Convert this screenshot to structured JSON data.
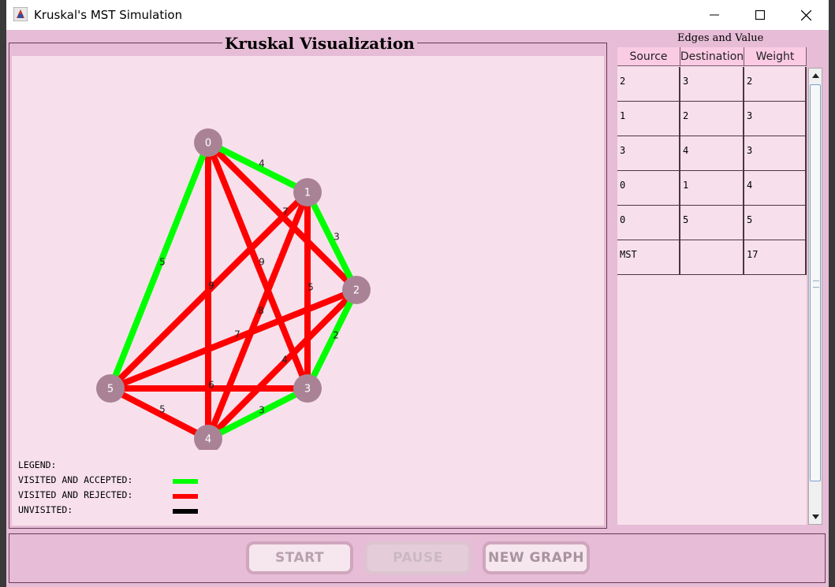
{
  "window": {
    "title": "Kruskal's MST Simulation"
  },
  "visualization": {
    "title": "Kruskal Visualization",
    "colors": {
      "accepted": "#00ff00",
      "rejected": "#ff0000",
      "unvisited": "#000000",
      "node": "#a98395"
    },
    "nodes": [
      {
        "id": "0"
      },
      {
        "id": "1"
      },
      {
        "id": "2"
      },
      {
        "id": "3"
      },
      {
        "id": "4"
      },
      {
        "id": "5"
      }
    ],
    "edges": [
      {
        "from": "0",
        "to": "1",
        "weight": "4",
        "status": "accepted"
      },
      {
        "from": "1",
        "to": "2",
        "weight": "3",
        "status": "accepted"
      },
      {
        "from": "2",
        "to": "3",
        "weight": "2",
        "status": "accepted"
      },
      {
        "from": "3",
        "to": "4",
        "weight": "3",
        "status": "accepted"
      },
      {
        "from": "0",
        "to": "5",
        "weight": "5",
        "status": "accepted"
      },
      {
        "from": "0",
        "to": "4",
        "weight": "9",
        "status": "rejected"
      },
      {
        "from": "0",
        "to": "3",
        "weight": "9",
        "status": "rejected"
      },
      {
        "from": "0",
        "to": "2",
        "weight": "7",
        "status": "rejected"
      },
      {
        "from": "1",
        "to": "3",
        "weight": "5",
        "status": "rejected"
      },
      {
        "from": "1",
        "to": "4",
        "weight": "8",
        "status": "rejected"
      },
      {
        "from": "1",
        "to": "5",
        "weight": "9",
        "status": "rejected"
      },
      {
        "from": "2",
        "to": "4",
        "weight": "4",
        "status": "rejected"
      },
      {
        "from": "2",
        "to": "5",
        "weight": "7",
        "status": "rejected"
      },
      {
        "from": "3",
        "to": "5",
        "weight": "6",
        "status": "rejected"
      },
      {
        "from": "4",
        "to": "5",
        "weight": "5",
        "status": "rejected"
      }
    ],
    "legend": {
      "title": "LEGEND:",
      "accepted": "VISITED AND ACCEPTED:",
      "rejected": "VISITED AND REJECTED:",
      "unvisited": "UNVISITED:"
    }
  },
  "edges_table": {
    "title": "Edges and Value",
    "headers": [
      "Source",
      "Destination",
      "Weight"
    ],
    "rows": [
      [
        "2",
        "3",
        "2"
      ],
      [
        "1",
        "2",
        "3"
      ],
      [
        "3",
        "4",
        "3"
      ],
      [
        "0",
        "1",
        "4"
      ],
      [
        "0",
        "5",
        "5"
      ],
      [
        "MST",
        "",
        "17"
      ]
    ]
  },
  "controls": {
    "start": "START",
    "pause": "PAUSE",
    "new_graph": "NEW GRAPH"
  }
}
